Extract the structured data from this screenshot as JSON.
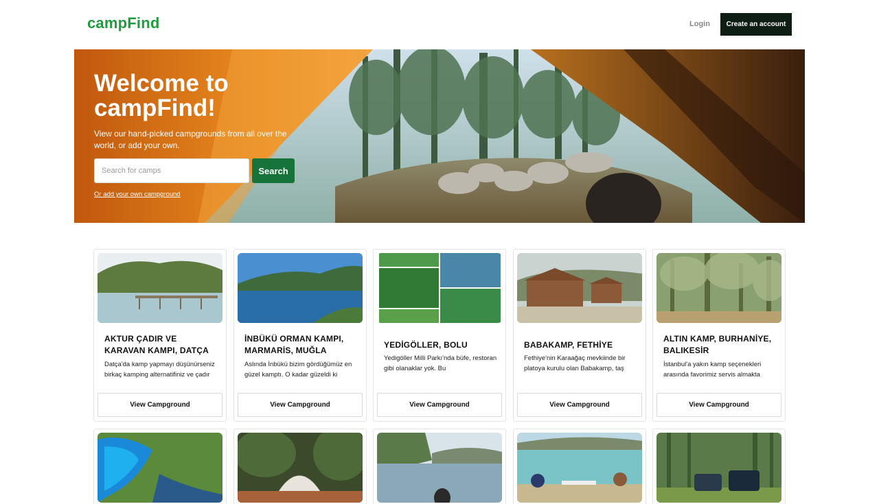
{
  "header": {
    "logo": "campFind",
    "login_label": "Login",
    "create_account_label": "Create an account"
  },
  "hero": {
    "title": "Welcome to campFind!",
    "subtitle": "View our hand-picked campgrounds from all over the world, or add your own.",
    "search_placeholder": "Search for camps",
    "search_value": "",
    "search_button": "Search",
    "add_link": "Or add your own campground"
  },
  "campgrounds": [
    {
      "title": "AKTUR ÇADIR VE KARAVAN KAMPI, DATÇA",
      "description": "Datça'da kamp yapmayı düşünürseniz birkaç kamping alternatifiniz ve çadır",
      "button": "View Campground"
    },
    {
      "title": "İNBÜKÜ ORMAN KAMPI, MARMARİS, MUĞLA",
      "description": "Aslında İnbükü bizim gördüğümüz en güzel kamptı. O kadar güzeldi ki",
      "button": "View Campground"
    },
    {
      "title": "YEDİGÖLLER, BOLU",
      "description": "Yedigöller Milli Parkı'nda büfe, restoran gibi olanaklar yok. Bu",
      "button": "View Campground"
    },
    {
      "title": "BABAKAMP, FETHİYE",
      "description": "Fethiye'nin Karaağaç mevkiinde bir platoya kurulu olan Babakamp, taş",
      "button": "View Campground"
    },
    {
      "title": "ALTIN KAMP, BURHANİYE, BALIKESİR",
      "description": "İstanbul'a yakın kamp seçenekleri arasında favorimiz servis almakta",
      "button": "View Campground"
    }
  ],
  "icons": [
    "search-icon"
  ],
  "colors": {
    "brand": "#1e9d3c",
    "search_button": "#16743a",
    "create_button": "#0f1e14"
  }
}
